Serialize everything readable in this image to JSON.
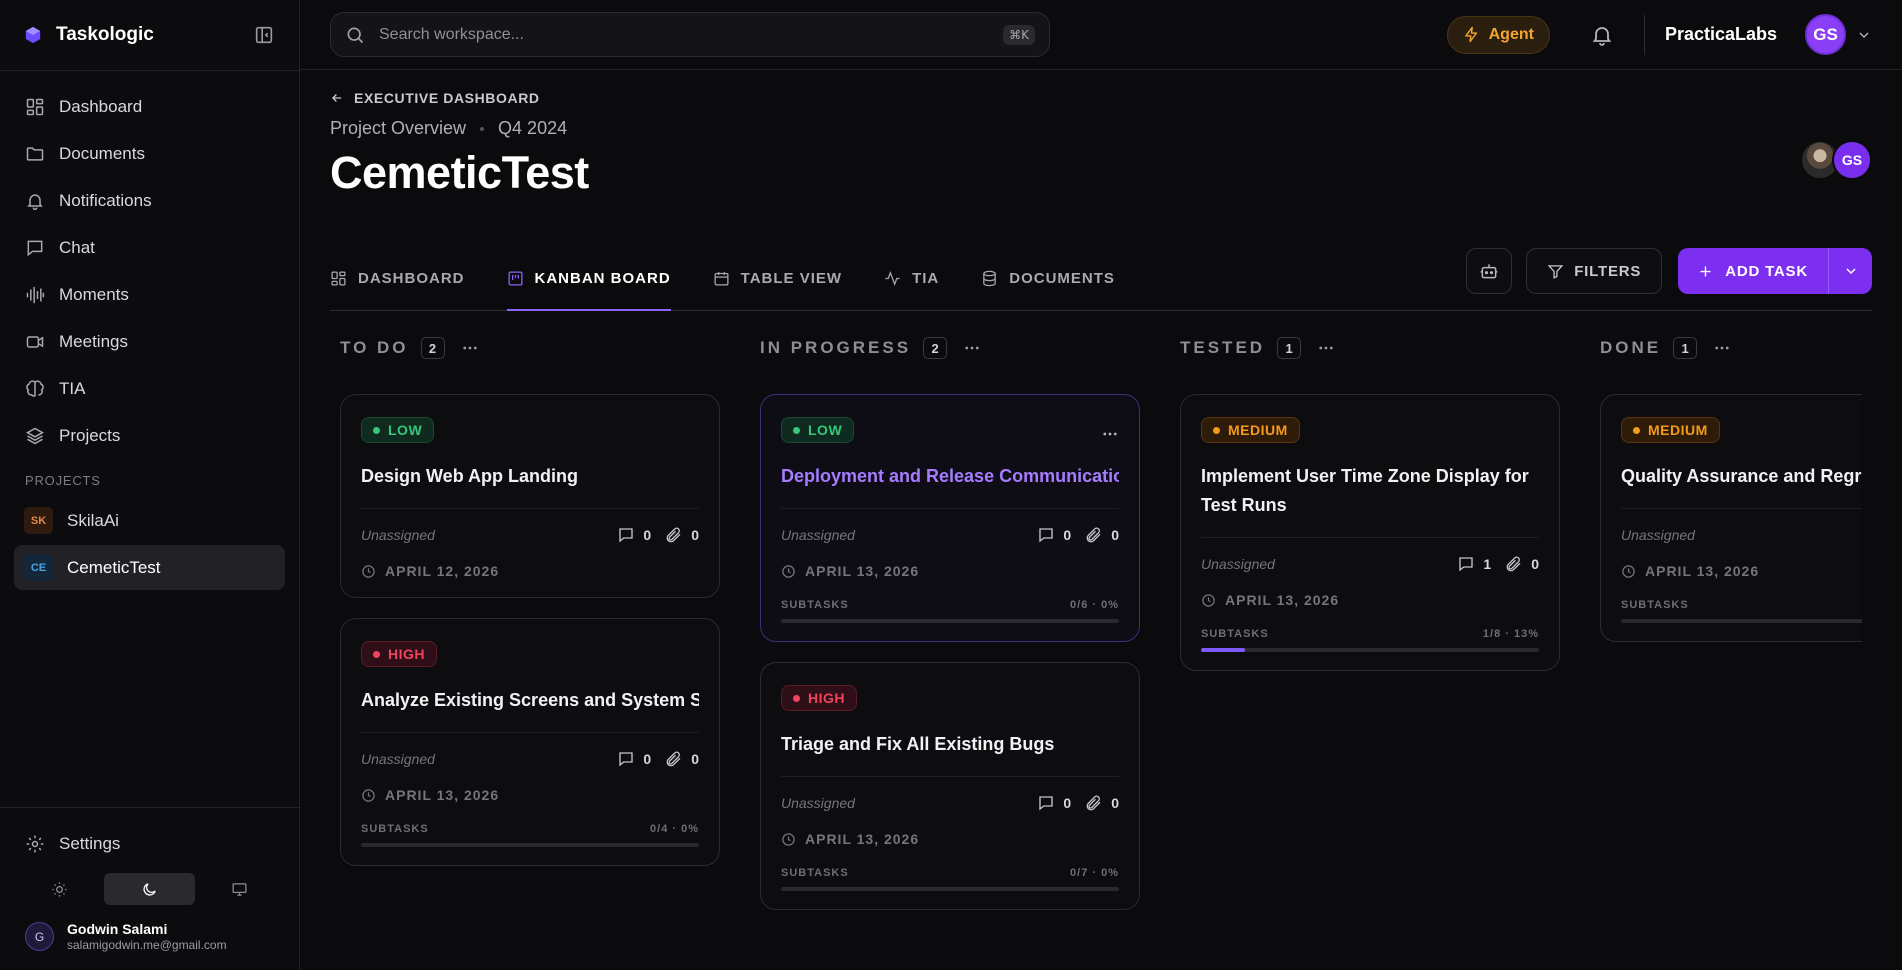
{
  "sidebar": {
    "brand": "Taskologic",
    "nav": [
      {
        "label": "Dashboard",
        "icon": "dashboard-icon"
      },
      {
        "label": "Documents",
        "icon": "folder-icon"
      },
      {
        "label": "Notifications",
        "icon": "bell-icon"
      },
      {
        "label": "Chat",
        "icon": "chat-icon"
      },
      {
        "label": "Moments",
        "icon": "audio-wave-icon"
      },
      {
        "label": "Meetings",
        "icon": "video-icon"
      },
      {
        "label": "TIA",
        "icon": "brain-icon"
      },
      {
        "label": "Projects",
        "icon": "layers-icon"
      }
    ],
    "projects_heading": "PROJECTS",
    "projects": [
      {
        "badge": "SK",
        "label": "SkilaAi",
        "badge_color": "#e0874a"
      },
      {
        "badge": "CE",
        "label": "CemeticTest",
        "badge_color": "#4aa6e0"
      }
    ],
    "settings_label": "Settings",
    "user": {
      "initial": "G",
      "name": "Godwin Salami",
      "email": "salamigodwin.me@gmail.com"
    }
  },
  "topbar": {
    "search_placeholder": "Search workspace...",
    "shortcut": "⌘K",
    "agent_label": "Agent",
    "org_name": "PracticaLabs",
    "avatar_initials": "GS"
  },
  "page": {
    "back_label": "EXECUTIVE DASHBOARD",
    "breadcrumb": [
      "Project Overview",
      "Q4 2024"
    ],
    "title": "CemeticTest",
    "member_initials": "GS"
  },
  "tabs": [
    {
      "label": "DASHBOARD",
      "icon": "dashboard-icon"
    },
    {
      "label": "KANBAN BOARD",
      "icon": "kanban-icon"
    },
    {
      "label": "TABLE VIEW",
      "icon": "calendar-icon"
    },
    {
      "label": "TIA",
      "icon": "activity-icon"
    },
    {
      "label": "DOCUMENTS",
      "icon": "database-icon"
    }
  ],
  "actions": {
    "filters_label": "FILTERS",
    "add_task_label": "ADD TASK"
  },
  "columns": [
    {
      "title": "TO DO",
      "count": "2",
      "cards": [
        {
          "priority": "LOW",
          "title": "Design Web App Landing",
          "assignee": "Unassigned",
          "comments": "0",
          "attachments": "0",
          "date": "APRIL 12, 2026"
        },
        {
          "priority": "HIGH",
          "title": "Analyze Existing Screens and System State",
          "assignee": "Unassigned",
          "comments": "0",
          "attachments": "0",
          "date": "APRIL 13, 2026",
          "subtasks_label": "SUBTASKS",
          "subtasks_text": "0/4 · 0%",
          "progress": 0
        }
      ]
    },
    {
      "title": "IN PROGRESS",
      "count": "2",
      "cards": [
        {
          "priority": "LOW",
          "title": "Deployment and Release Communication",
          "assignee": "Unassigned",
          "comments": "0",
          "attachments": "0",
          "date": "APRIL 13, 2026",
          "subtasks_label": "SUBTASKS",
          "subtasks_text": "0/6 · 0%",
          "progress": 0
        },
        {
          "priority": "HIGH",
          "title": "Triage and Fix All Existing Bugs",
          "assignee": "Unassigned",
          "comments": "0",
          "attachments": "0",
          "date": "APRIL 13, 2026",
          "subtasks_label": "SUBTASKS",
          "subtasks_text": "0/7 · 0%",
          "progress": 0
        }
      ]
    },
    {
      "title": "TESTED",
      "count": "1",
      "cards": [
        {
          "priority": "MEDIUM",
          "title": "Implement User Time Zone Display for Test Runs",
          "assignee": "Unassigned",
          "comments": "1",
          "attachments": "0",
          "date": "APRIL 13, 2026",
          "subtasks_label": "SUBTASKS",
          "subtasks_text": "1/8 · 13%",
          "progress": 0.13
        }
      ]
    },
    {
      "title": "DONE",
      "count": "1",
      "cards": [
        {
          "priority": "MEDIUM",
          "title": "Quality Assurance and Regress",
          "assignee": "Unassigned",
          "date": "APRIL 13, 2026",
          "subtasks_label": "SUBTASKS"
        }
      ]
    }
  ]
}
